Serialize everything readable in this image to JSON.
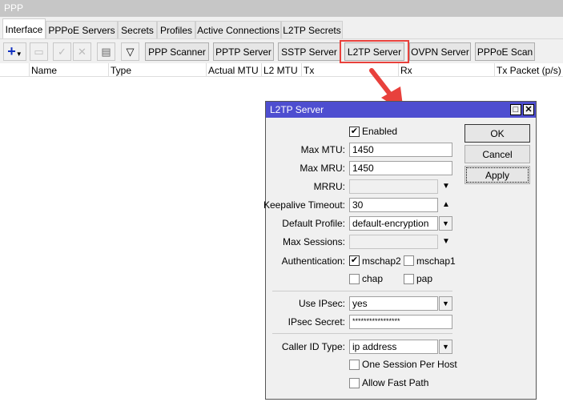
{
  "window": {
    "title": "PPP"
  },
  "tabs": [
    "Interface",
    "PPPoE Servers",
    "Secrets",
    "Profiles",
    "Active Connections",
    "L2TP Secrets"
  ],
  "toolbar": {
    "buttons": [
      "PPP Scanner",
      "PPTP Server",
      "SSTP Server",
      "L2TP Server",
      "OVPN Server",
      "PPPoE Scan"
    ],
    "icons": [
      "plus-icon",
      "minus-icon",
      "check-icon",
      "cross-icon",
      "comment-icon",
      "filter-icon"
    ]
  },
  "table": {
    "columns": [
      "",
      "Name",
      "Type",
      "Actual MTU",
      "L2 MTU",
      "Tx",
      "Rx",
      "Tx Packet (p/s)"
    ]
  },
  "dialog": {
    "title": "L2TP Server",
    "enabled_label": "Enabled",
    "enabled": true,
    "fields": {
      "max_mtu": {
        "label": "Max MTU:",
        "value": "1450"
      },
      "max_mru": {
        "label": "Max MRU:",
        "value": "1450"
      },
      "mrru": {
        "label": "MRRU:",
        "value": ""
      },
      "keepalive": {
        "label": "Keepalive Timeout:",
        "value": "30"
      },
      "default_profile": {
        "label": "Default Profile:",
        "value": "default-encryption"
      },
      "max_sessions": {
        "label": "Max Sessions:",
        "value": ""
      },
      "authentication": {
        "label": "Authentication:",
        "options": [
          {
            "label": "mschap2",
            "checked": true
          },
          {
            "label": "mschap1",
            "checked": false
          },
          {
            "label": "chap",
            "checked": false
          },
          {
            "label": "pap",
            "checked": false
          }
        ]
      },
      "use_ipsec": {
        "label": "Use IPsec:",
        "value": "yes"
      },
      "ipsec_secret": {
        "label": "IPsec Secret:",
        "value": "*****************"
      },
      "caller_id": {
        "label": "Caller ID Type:",
        "value": "ip address"
      },
      "one_session": {
        "label": "One Session Per Host",
        "checked": false
      },
      "fast_path": {
        "label": "Allow Fast Path",
        "checked": false
      }
    },
    "buttons": {
      "ok": "OK",
      "cancel": "Cancel",
      "apply": "Apply"
    }
  },
  "colors": {
    "dialog_title": "#4e4ed0",
    "highlight": "#e8413c"
  }
}
